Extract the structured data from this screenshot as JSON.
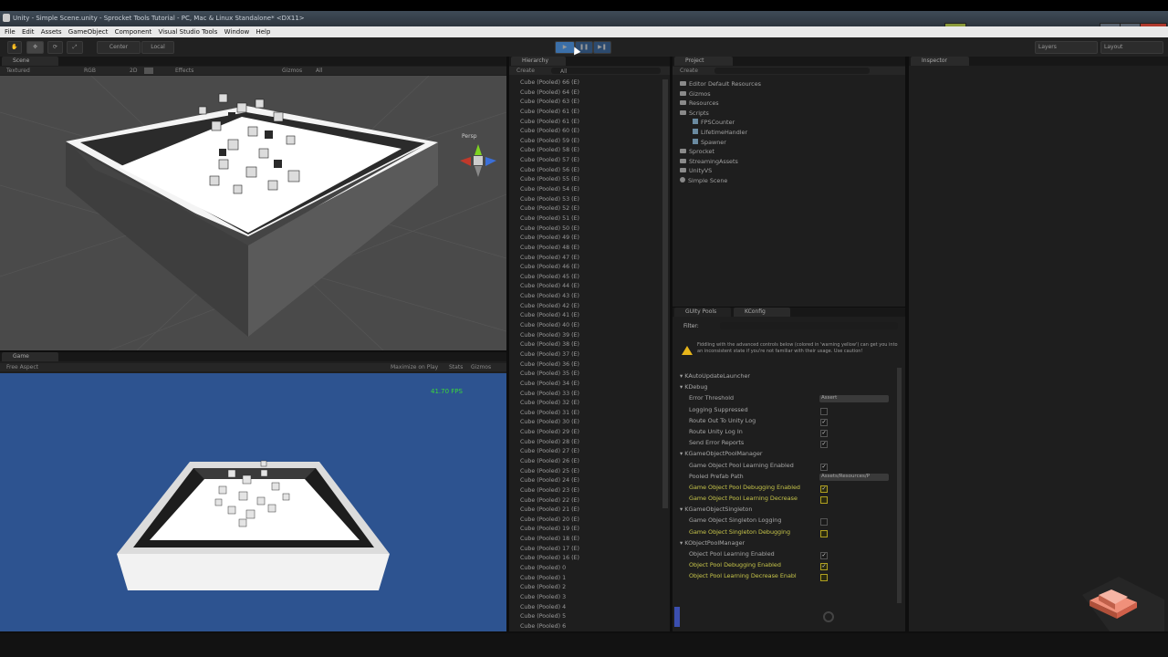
{
  "window": {
    "title": "Unity - Simple Scene.unity - Sprocket Tools Tutorial - PC, Mac & Linux Standalone* <DX11>"
  },
  "menu": [
    "File",
    "Edit",
    "Assets",
    "GameObject",
    "Component",
    "Visual Studio Tools",
    "Window",
    "Help"
  ],
  "toolbar": {
    "pivot": "Center",
    "space": "Local",
    "layers": "Layers",
    "layout": "Layout"
  },
  "scene": {
    "tab": "Scene",
    "shading": "Textured",
    "render": "RGB",
    "mode2d": "2D",
    "effects": "Effects",
    "gizmos": "Gizmos",
    "search": "All",
    "persp": "Persp"
  },
  "game": {
    "tab": "Game",
    "aspect": "Free Aspect",
    "maximize": "Maximize on Play",
    "stats": "Stats",
    "gizmos": "Gizmos",
    "fps": "41.70 FPS"
  },
  "hierarchy": {
    "tab": "Hierarchy",
    "create": "Create",
    "search": "All",
    "items": [
      "Cube (Pooled) 66 (E)",
      "Cube (Pooled) 64 (E)",
      "Cube (Pooled) 63 (E)",
      "Cube (Pooled) 61 (E)",
      "Cube (Pooled) 61 (E)",
      "Cube (Pooled) 60 (E)",
      "Cube (Pooled) 59 (E)",
      "Cube (Pooled) 58 (E)",
      "Cube (Pooled) 57 (E)",
      "Cube (Pooled) 56 (E)",
      "Cube (Pooled) 55 (E)",
      "Cube (Pooled) 54 (E)",
      "Cube (Pooled) 53 (E)",
      "Cube (Pooled) 52 (E)",
      "Cube (Pooled) 51 (E)",
      "Cube (Pooled) 50 (E)",
      "Cube (Pooled) 49 (E)",
      "Cube (Pooled) 48 (E)",
      "Cube (Pooled) 47 (E)",
      "Cube (Pooled) 46 (E)",
      "Cube (Pooled) 45 (E)",
      "Cube (Pooled) 44 (E)",
      "Cube (Pooled) 43 (E)",
      "Cube (Pooled) 42 (E)",
      "Cube (Pooled) 41 (E)",
      "Cube (Pooled) 40 (E)",
      "Cube (Pooled) 39 (E)",
      "Cube (Pooled) 38 (E)",
      "Cube (Pooled) 37 (E)",
      "Cube (Pooled) 36 (E)",
      "Cube (Pooled) 35 (E)",
      "Cube (Pooled) 34 (E)",
      "Cube (Pooled) 33 (E)",
      "Cube (Pooled) 32 (E)",
      "Cube (Pooled) 31 (E)",
      "Cube (Pooled) 30 (E)",
      "Cube (Pooled) 29 (E)",
      "Cube (Pooled) 28 (E)",
      "Cube (Pooled) 27 (E)",
      "Cube (Pooled) 26 (E)",
      "Cube (Pooled) 25 (E)",
      "Cube (Pooled) 24 (E)",
      "Cube (Pooled) 23 (E)",
      "Cube (Pooled) 22 (E)",
      "Cube (Pooled) 21 (E)",
      "Cube (Pooled) 20 (E)",
      "Cube (Pooled) 19 (E)",
      "Cube (Pooled) 18 (E)",
      "Cube (Pooled) 17 (E)",
      "Cube (Pooled) 16 (E)",
      "Cube (Pooled) 0",
      "Cube (Pooled) 1",
      "Cube (Pooled) 2",
      "Cube (Pooled) 3",
      "Cube (Pooled) 4",
      "Cube (Pooled) 5",
      "Cube (Pooled) 6"
    ]
  },
  "project": {
    "tab": "Project",
    "create": "Create",
    "items": [
      {
        "label": "Editor Default Resources",
        "indent": 0,
        "kind": "folder"
      },
      {
        "label": "Gizmos",
        "indent": 0,
        "kind": "folder"
      },
      {
        "label": "Resources",
        "indent": 0,
        "kind": "folder"
      },
      {
        "label": "Scripts",
        "indent": 0,
        "kind": "folder"
      },
      {
        "label": "FPSCounter",
        "indent": 1,
        "kind": "script"
      },
      {
        "label": "LifetimeHandler",
        "indent": 1,
        "kind": "script"
      },
      {
        "label": "Spawner",
        "indent": 1,
        "kind": "script"
      },
      {
        "label": "Sprocket",
        "indent": 0,
        "kind": "folder"
      },
      {
        "label": "StreamingAssets",
        "indent": 0,
        "kind": "folder"
      },
      {
        "label": "UnityVS",
        "indent": 0,
        "kind": "folder"
      },
      {
        "label": "Simple Scene",
        "indent": 0,
        "kind": "scene"
      }
    ]
  },
  "inspector": {
    "tab": "Inspector"
  },
  "kconfig": {
    "tabs": [
      "GUIty Pools",
      "KConfig"
    ],
    "filter": "Filter:",
    "warning": "Fiddling with the advanced controls below (colored in 'warning yellow') can get you into an inconsistent state if you're not familiar with their usage. Use caution!",
    "rows": [
      {
        "label": "KAutoUpdateLauncher",
        "type": "section"
      },
      {
        "label": "KDebug",
        "type": "section"
      },
      {
        "label": "Error Threshold",
        "type": "dropdown",
        "value": "Assert"
      },
      {
        "label": "Logging Suppressed",
        "type": "check",
        "checked": false
      },
      {
        "label": "Route Out To Unity Log",
        "type": "check",
        "checked": true
      },
      {
        "label": "Route Unity Log In",
        "type": "check",
        "checked": true
      },
      {
        "label": "Send Error Reports",
        "type": "check",
        "checked": true
      },
      {
        "label": "KGameObjectPoolManager",
        "type": "section"
      },
      {
        "label": "Game Object Pool Learning Enabled",
        "type": "check",
        "checked": true
      },
      {
        "label": "Pooled Prefab Path",
        "type": "dropdown",
        "value": "Assets/Resources/P"
      },
      {
        "label": "Game Object Pool Debugging Enabled",
        "type": "check",
        "checked": true,
        "warn": true
      },
      {
        "label": "Game Object Pool Learning Decrease",
        "type": "check",
        "checked": false,
        "warn": true
      },
      {
        "label": "KGameObjectSingleton",
        "type": "section"
      },
      {
        "label": "Game Object Singleton Logging",
        "type": "check",
        "checked": false
      },
      {
        "label": "Game Object Singleton Debugging",
        "type": "check",
        "checked": false,
        "warn": true
      },
      {
        "label": "KObjectPoolManager",
        "type": "section"
      },
      {
        "label": "Object Pool Learning Enabled",
        "type": "check",
        "checked": true
      },
      {
        "label": "Object Pool Debugging Enabled",
        "type": "check",
        "checked": true,
        "warn": true
      },
      {
        "label": "Object Pool Learning Decrease Enabl",
        "type": "check",
        "checked": false,
        "warn": true
      }
    ]
  },
  "colors": {
    "game_bg": "#2d5390",
    "scene_bg": "#4a4a4a",
    "warn": "#c8c64a",
    "fps": "#3ad83a"
  }
}
